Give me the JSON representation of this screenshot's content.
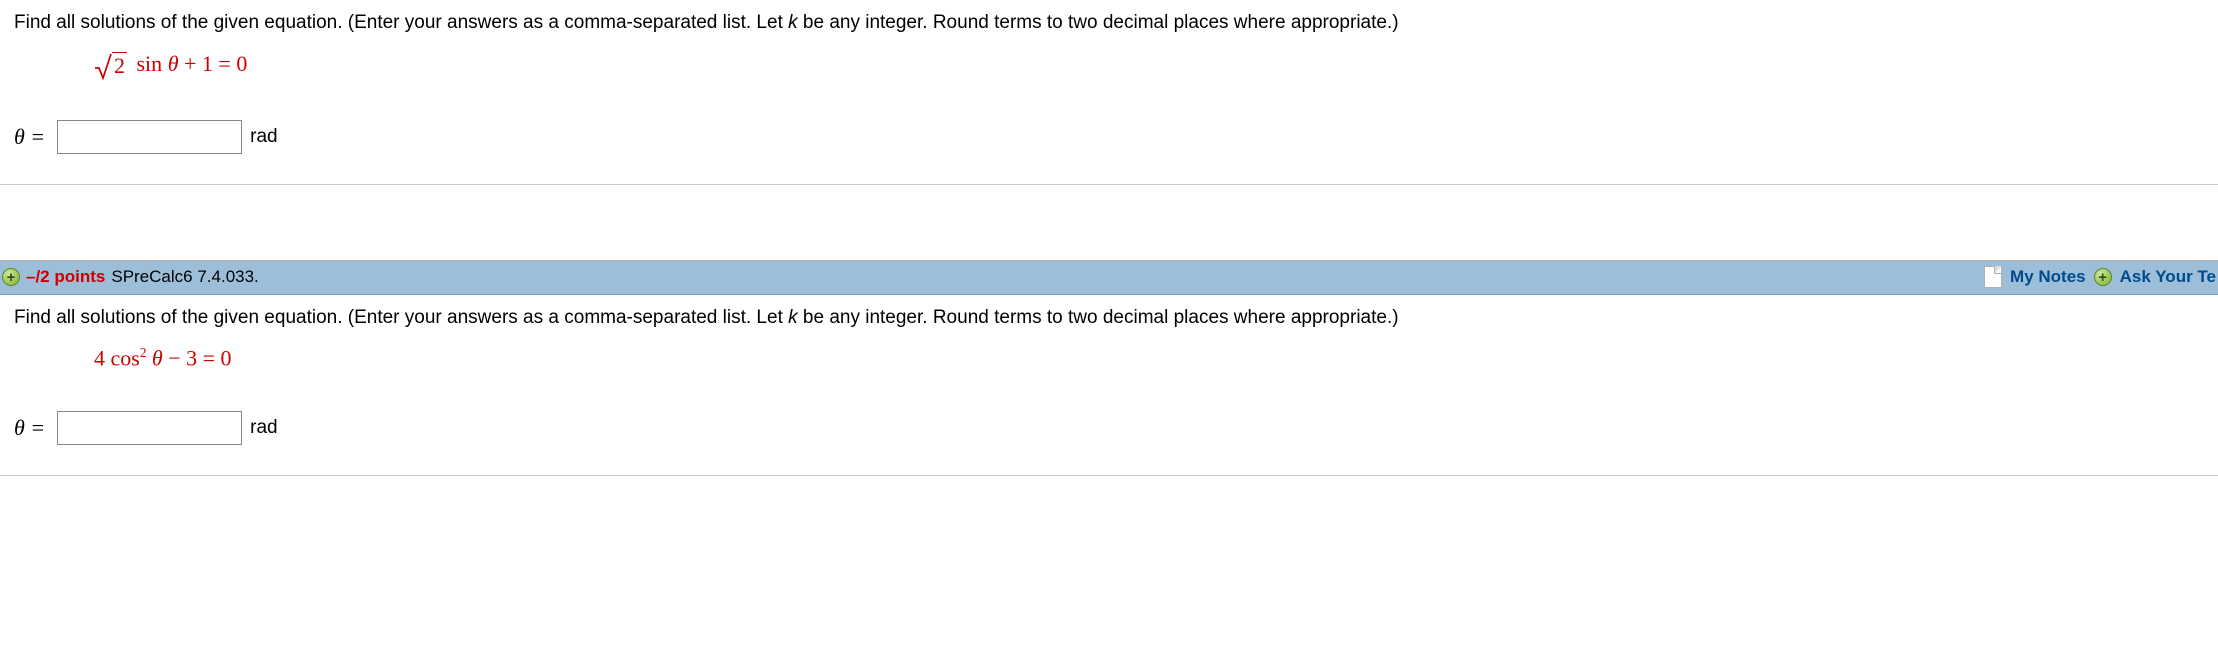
{
  "q1": {
    "prompt_pre": "Find all solutions of the given equation. (Enter your answers as a comma-separated list. Let ",
    "prompt_k": "k",
    "prompt_post": " be any integer. Round terms to two decimal places where appropriate.)",
    "eq": {
      "radicand": "2",
      "rest": "  sin θ + 1 = 0"
    },
    "answer_label": "θ =",
    "unit": "rad"
  },
  "header": {
    "points": "–/2 points",
    "source": "SPreCalc6 7.4.033.",
    "my_notes": "My Notes",
    "ask": "Ask Your Te"
  },
  "q2": {
    "prompt_pre": "Find all solutions of the given equation. (Enter your answers as a comma-separated list. Let ",
    "prompt_k": "k",
    "prompt_post": " be any integer. Round terms to two decimal places where appropriate.)",
    "eq": {
      "full": "4 cos² θ − 3 = 0",
      "pre": "4 cos",
      "sup": "2",
      "post": " θ − 3 = 0"
    },
    "answer_label": "θ =",
    "unit": "rad"
  }
}
